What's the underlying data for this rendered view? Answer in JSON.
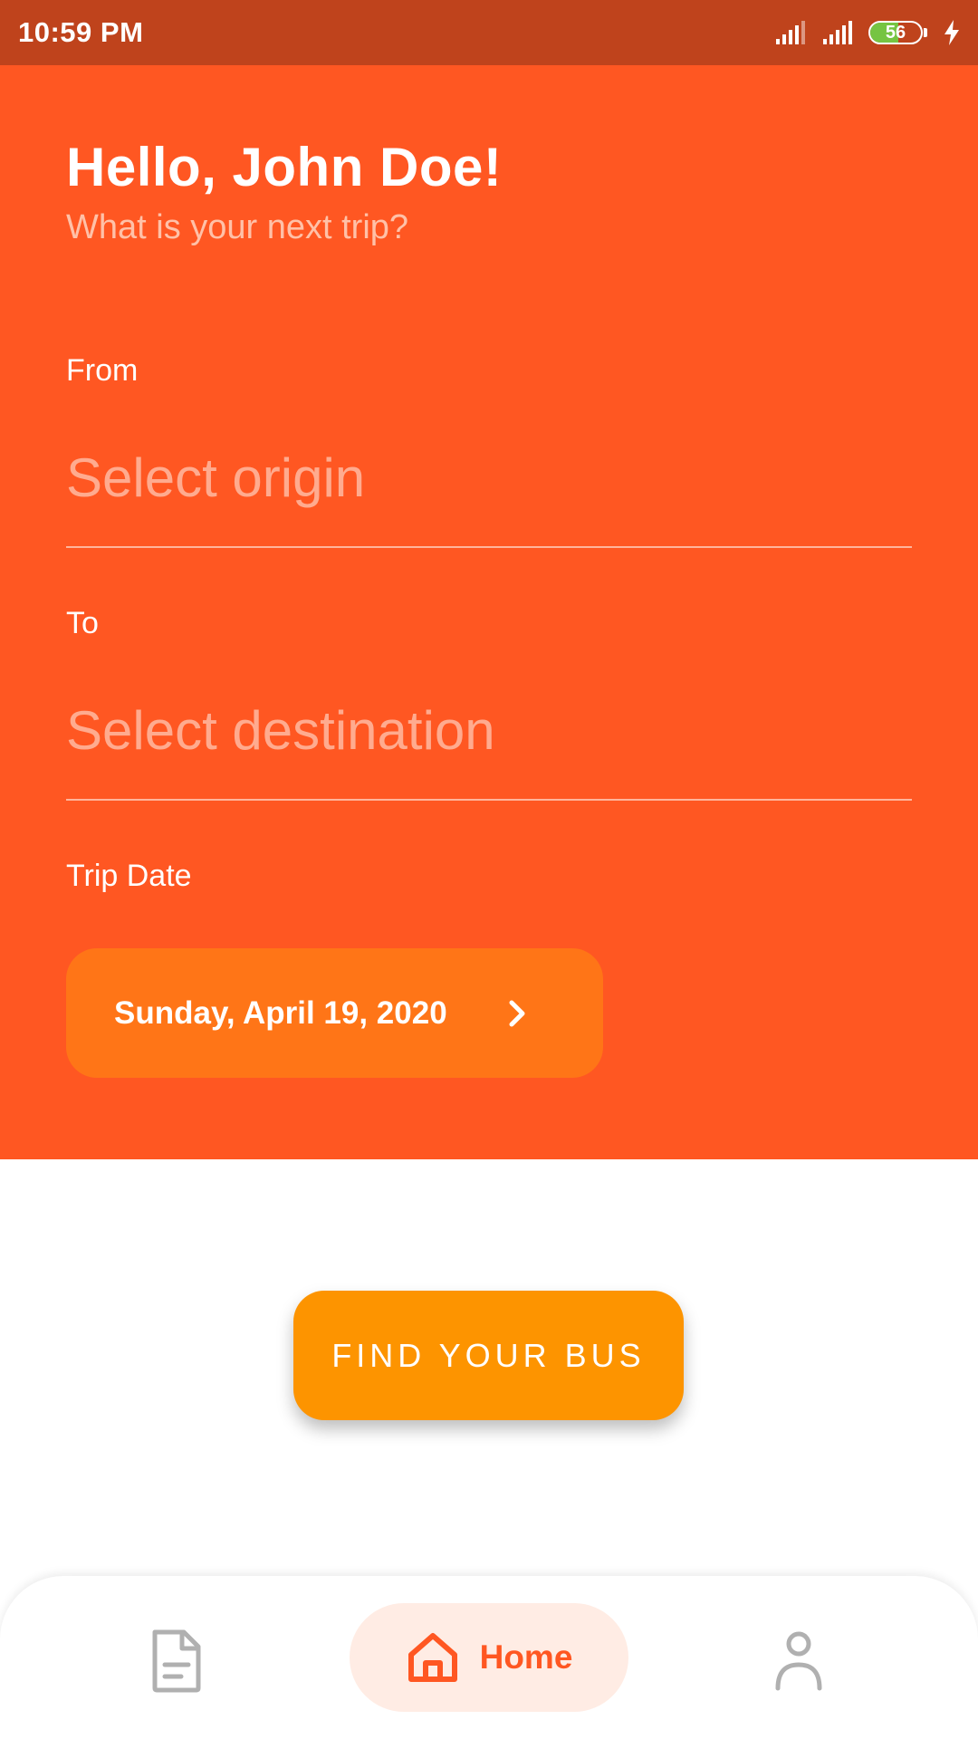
{
  "status_bar": {
    "time": "10:59 PM",
    "battery_level": "56",
    "battery_fraction": 0.56,
    "icons": [
      "signal-icon",
      "signal-icon",
      "battery-icon",
      "charging-icon"
    ]
  },
  "header": {
    "greeting": "Hello, John Doe!",
    "subtitle": "What is your next trip?"
  },
  "form": {
    "from_label": "From",
    "from_placeholder": "Select origin",
    "to_label": "To",
    "to_placeholder": "Select destination",
    "date_label": "Trip Date",
    "date_value": "Sunday, April 19, 2020",
    "date_icon": "chevron-right-icon"
  },
  "actions": {
    "find_label": "FIND YOUR BUS"
  },
  "bottom_nav": {
    "items": [
      {
        "icon": "document-icon",
        "label": ""
      },
      {
        "icon": "home-icon",
        "label": "Home",
        "active": true
      },
      {
        "icon": "person-icon",
        "label": ""
      }
    ]
  },
  "colors": {
    "status_bar": "#bf431c",
    "header": "#ff5722",
    "date_button": "#ff7517",
    "find_button": "#fd9400",
    "nav_active_bg": "#ffece4",
    "nav_icon_inactive": "#b0b0b0"
  }
}
